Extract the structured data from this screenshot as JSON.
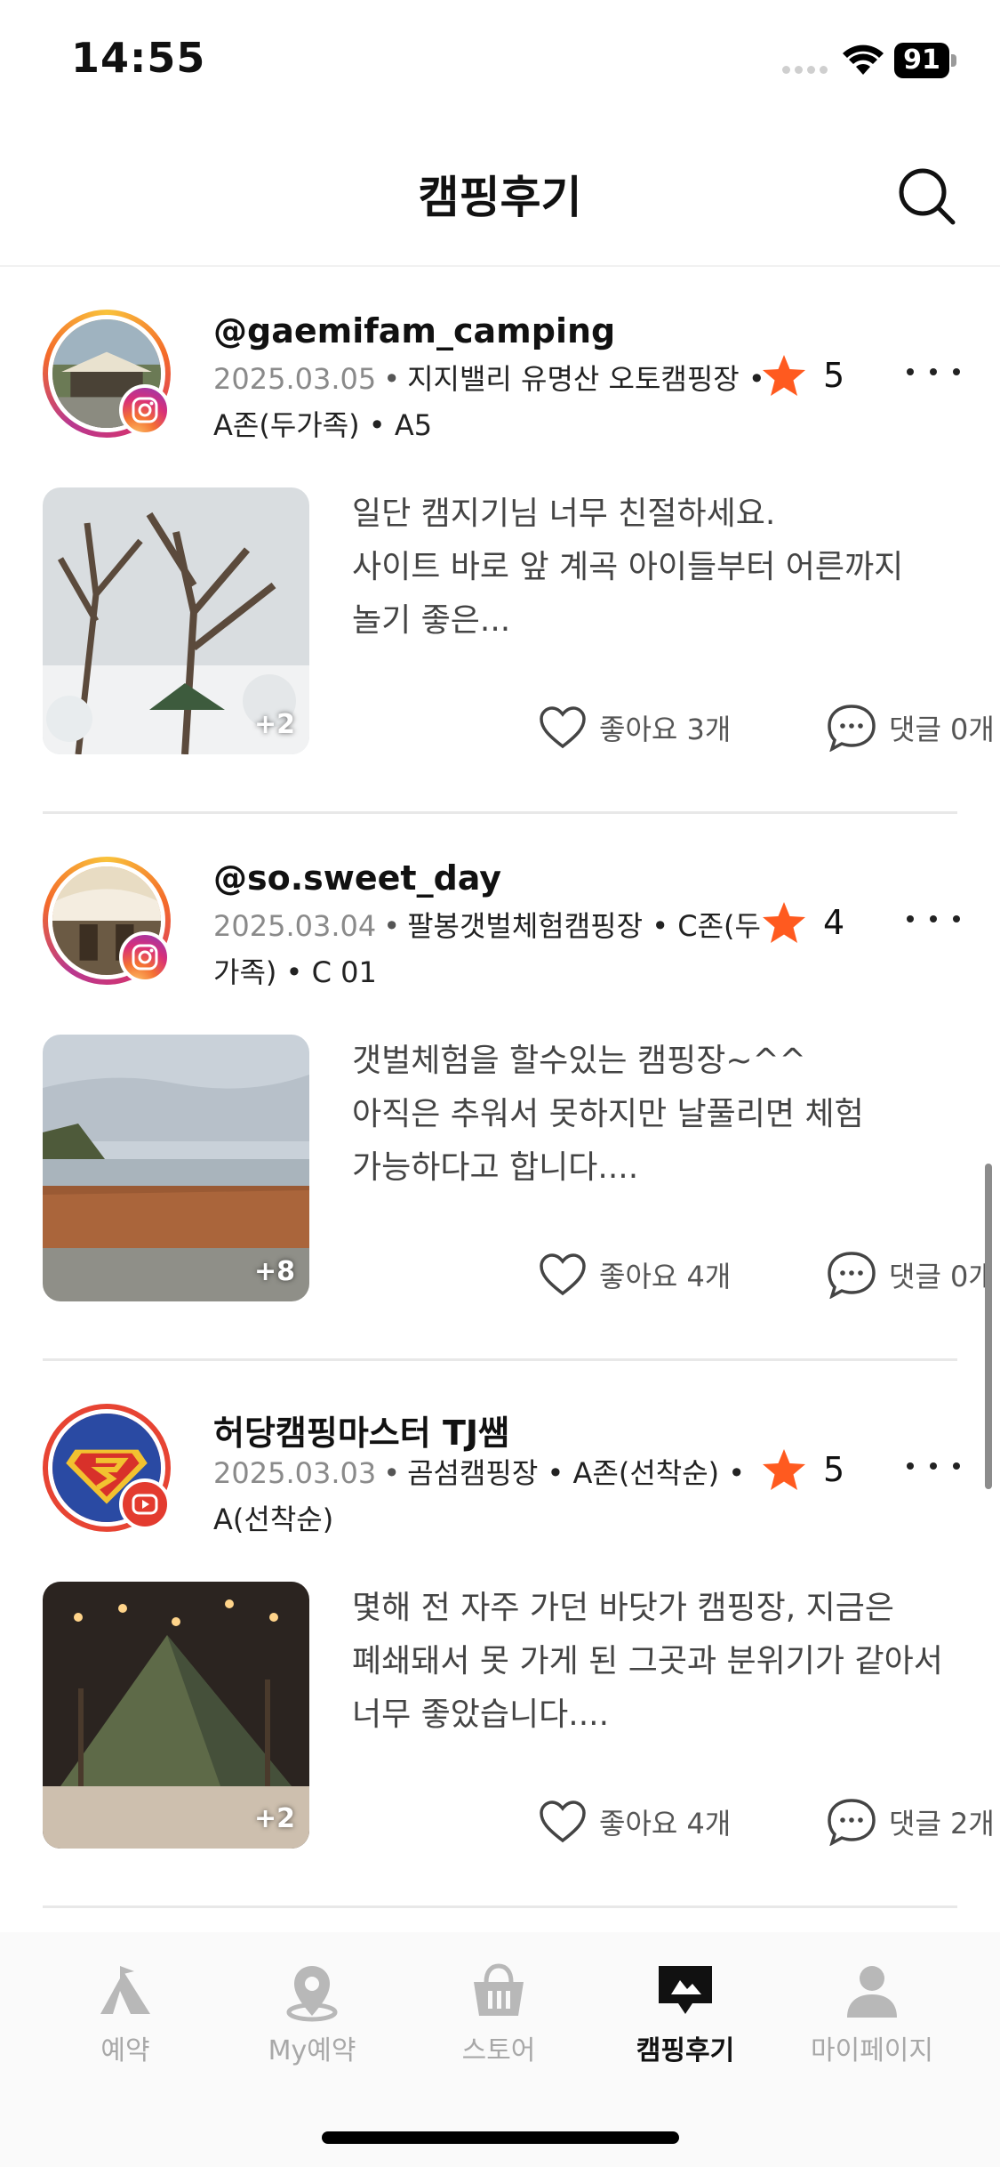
{
  "status_bar": {
    "time": "14:55",
    "battery": "91"
  },
  "header": {
    "title": "캠핑후기"
  },
  "reviews": [
    {
      "author": "@gaemifam_camping",
      "platform": "instagram",
      "date": "2025.03.05",
      "meta_line": "지지밸리 유명산 오토캠핑장 • A존(두가족) • A5",
      "rating": "5",
      "excerpt": "일단 캠지기님 너무 친절하세요.\n사이트 바로 앞 계곡 아이들부터 어른까지 놀기 좋은...",
      "photo_count": "+2",
      "likes": "좋아요 3개",
      "comments": "댓글 0개"
    },
    {
      "author": "@so.sweet_day",
      "platform": "instagram",
      "date": "2025.03.04",
      "meta_line": "팔봉갯벌체험캠핑장 • C존(두가족) • C 01",
      "rating": "4",
      "excerpt": "갯벌체험을 할수있는 캠핑장~^^\n아직은 추워서 못하지만 날풀리면 체험 가능하다고 합니다....",
      "photo_count": "+8",
      "likes": "좋아요 4개",
      "comments": "댓글 0개"
    },
    {
      "author": "허당캠핑마스터 TJ쌤",
      "platform": "youtube",
      "date": "2025.03.03",
      "meta_line": "곰섬캠핑장 • A존(선착순) • A(선착순)",
      "rating": "5",
      "excerpt": "몇해 전 자주 가던 바닷가 캠핑장, 지금은 폐쇄돼서 못 가게 된 그곳과 분위기가 같아서 너무 좋았습니다....",
      "photo_count": "+2",
      "likes": "좋아요 4개",
      "comments": "댓글 2개"
    }
  ],
  "tabs": [
    {
      "label": "예약",
      "icon": "tent-icon"
    },
    {
      "label": "My예약",
      "icon": "location-pin-icon"
    },
    {
      "label": "스토어",
      "icon": "basket-icon"
    },
    {
      "label": "캠핑후기",
      "icon": "review-bubble-icon",
      "active": true
    },
    {
      "label": "마이페이지",
      "icon": "person-icon"
    }
  ],
  "colors": {
    "accent_star": "#ff5a1f",
    "text_primary": "#111111",
    "text_secondary": "#8a8a8a"
  }
}
